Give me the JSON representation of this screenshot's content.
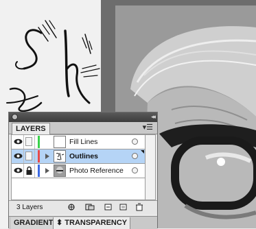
{
  "layers_panel": {
    "tab_label": "LAYERS",
    "menu_icon": "panel-menu-icon",
    "collapse_icon": "collapse-double-arrow-icon",
    "layers": [
      {
        "name": "Fill Lines",
        "color": "#39d14a",
        "visible": true,
        "locked": false,
        "expandable": false,
        "selected": false
      },
      {
        "name": "Outlines",
        "color": "#e84a4a",
        "visible": true,
        "locked": false,
        "expandable": true,
        "selected": true
      },
      {
        "name": "Photo Reference",
        "color": "#3d6be3",
        "visible": true,
        "locked": true,
        "expandable": true,
        "selected": false
      }
    ],
    "layer_count": "3 Layers"
  },
  "bottom_tabs": {
    "gradient_label": "GRADIENT",
    "transparency_label": "TRANSPARENCY",
    "transparency_arrows": "⬍"
  },
  "colors": {
    "selection": "#b5d4f6",
    "panel_bg": "#e9e9e9",
    "artboard_bg": "#f1f1f1"
  }
}
